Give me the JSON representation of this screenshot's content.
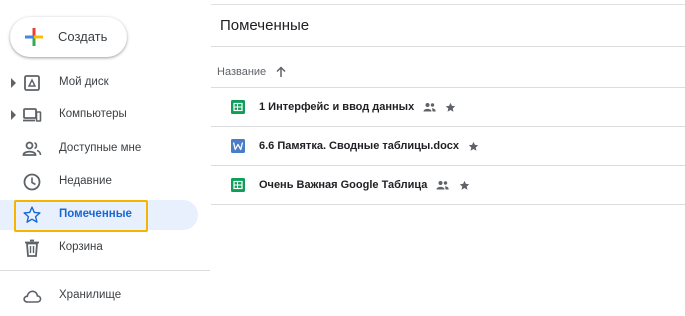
{
  "sidebar": {
    "create_label": "Создать",
    "items": [
      {
        "label": "Мой диск",
        "icon": "drive-icon",
        "expandable": true
      },
      {
        "label": "Компьютеры",
        "icon": "computers-icon",
        "expandable": true
      },
      {
        "label": "Доступные мне",
        "icon": "shared-icon",
        "expandable": false
      },
      {
        "label": "Недавние",
        "icon": "clock-icon",
        "expandable": false
      },
      {
        "label": "Помеченные",
        "icon": "star-icon",
        "expandable": false,
        "selected": true
      },
      {
        "label": "Корзина",
        "icon": "trash-icon",
        "expandable": false
      }
    ],
    "storage_label": "Хранилище",
    "highlight_color": "#f4b400",
    "selected_color": "#1967d2"
  },
  "main": {
    "title": "Помеченные",
    "column_header": "Название",
    "sort_direction": "ascending",
    "files": [
      {
        "name": "1 Интерфейс и ввод данных",
        "type": "google-sheets",
        "icon_color": "#0f9d58",
        "shared": true,
        "starred": true
      },
      {
        "name": "6.6 Памятка. Сводные таблицы.docx",
        "type": "word-docx",
        "icon_color": "#4a7cc7",
        "shared": false,
        "starred": true
      },
      {
        "name": "Очень Важная Google Таблица",
        "type": "google-sheets",
        "icon_color": "#0f9d58",
        "shared": true,
        "starred": true
      }
    ]
  }
}
